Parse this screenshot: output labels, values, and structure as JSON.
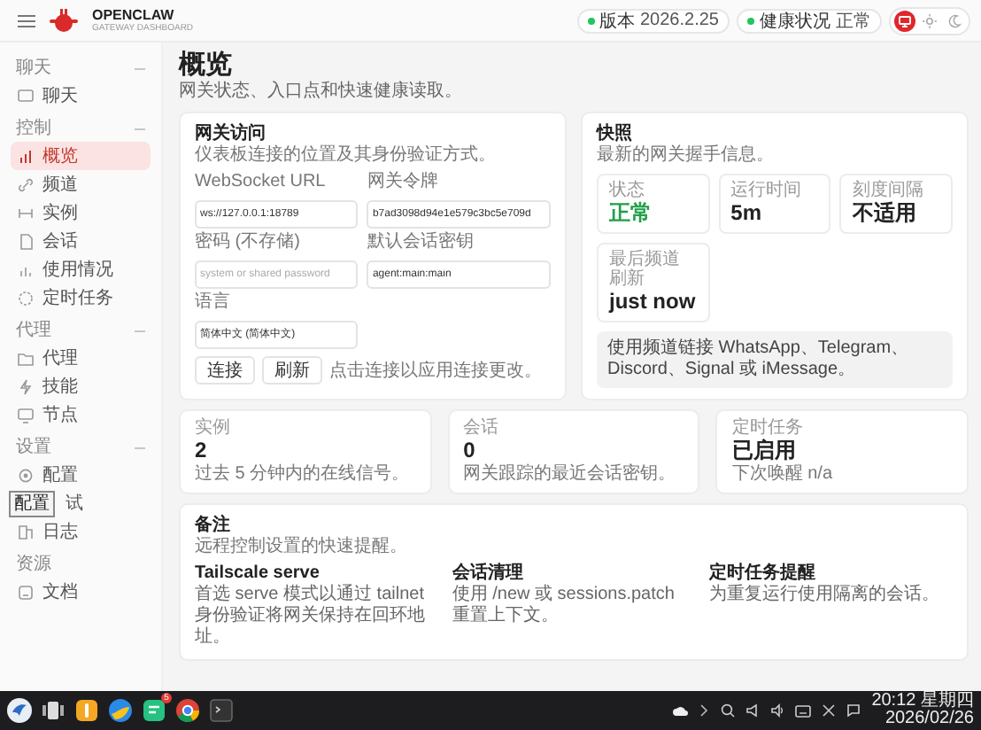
{
  "header": {
    "brand": "OPENCLAW",
    "subtitle": "GATEWAY DASHBOARD",
    "pills": [
      {
        "label": "版本",
        "value": "2026.2.25",
        "color": "#22c55e"
      },
      {
        "label": "健康状况",
        "value": "正常",
        "color": "#22c55e"
      }
    ],
    "theme_options": [
      {
        "selected": true
      },
      {
        "selected": false
      },
      {
        "selected": false
      }
    ]
  },
  "sidebar": {
    "sections": [
      {
        "title": "聊天",
        "collapsible": true,
        "items": [
          {
            "label": "聊天",
            "selected": false
          }
        ]
      },
      {
        "title": "控制",
        "collapsible": true,
        "items": [
          {
            "label": "概览",
            "selected": true
          },
          {
            "label": "频道",
            "selected": false
          },
          {
            "label": "实例",
            "selected": false
          },
          {
            "label": "会话",
            "selected": false
          },
          {
            "label": "使用情况",
            "selected": false
          },
          {
            "label": "定时任务",
            "selected": false
          }
        ]
      },
      {
        "title": "代理",
        "collapsible": true,
        "items": [
          {
            "label": "代理",
            "selected": false
          },
          {
            "label": "技能",
            "selected": false
          },
          {
            "label": "节点",
            "selected": false
          }
        ]
      },
      {
        "title": "设置",
        "collapsible": true,
        "items": [
          {
            "label": "配置",
            "selected": false
          },
          {
            "label": "试",
            "selected": false,
            "tooltip": "配置"
          },
          {
            "label": "日志",
            "selected": false
          }
        ]
      },
      {
        "title": "资源",
        "collapsible": false,
        "items": [
          {
            "label": "文档",
            "selected": false
          }
        ]
      }
    ]
  },
  "page": {
    "title": "概览",
    "subtitle": "网关状态、入口点和快速健康读取。"
  },
  "gateway": {
    "title": "网关访问",
    "description": "仪表板连接的位置及其身份验证方式。",
    "fields": [
      {
        "label": "WebSocket URL",
        "value": "ws://127.0.0.1:18789"
      },
      {
        "label": "网关令牌",
        "value": "b7ad3098d94e1e579c3bc5e709d"
      },
      {
        "label": "密码 (不存储)",
        "placeholder": "system or shared password"
      },
      {
        "label": "默认会话密钥",
        "value": "agent:main:main"
      },
      {
        "label": "语言",
        "value": "简体中文 (简体中文)"
      }
    ],
    "buttons": [
      "连接",
      "刷新"
    ],
    "hint": "点击连接以应用连接更改。"
  },
  "snapshot": {
    "title": "快照",
    "description": "最新的网关握手信息。",
    "stats": [
      {
        "label": "状态",
        "value": "正常",
        "kind": "status"
      },
      {
        "label": "运行时间",
        "value": "5m",
        "kind": "metric"
      },
      {
        "label": "刻度间隔",
        "value": "不适用",
        "kind": "metric"
      },
      {
        "label": "最后频道刷新",
        "value": "just now",
        "kind": "metric"
      }
    ],
    "notice": "使用频道链接 WhatsApp、Telegram、Discord、Signal 或 iMessage。"
  },
  "stat_cards": [
    {
      "label": "实例",
      "value": "2",
      "note": "过去 5 分钟内的在线信号。"
    },
    {
      "label": "会话",
      "value": "0",
      "note": "网关跟踪的最近会话密钥。"
    },
    {
      "label": "定时任务",
      "value": "已启用",
      "note": "下次唤醒 n/a"
    }
  ],
  "notes": {
    "title": "备注",
    "description": "远程控制设置的快速提醒。",
    "items": [
      {
        "title": "Tailscale serve",
        "text": "首选 serve 模式以通过 tailnet 身份验证将网关保持在回环地址。"
      },
      {
        "title": "会话清理",
        "text": "使用 /new 或 sessions.patch 重置上下文。"
      },
      {
        "title": "定时任务提醒",
        "text": "为重复运行使用隔离的会话。"
      }
    ]
  },
  "taskbar": {
    "badge": "5",
    "time": "20:12 星期四",
    "date": "2026/02/26"
  }
}
